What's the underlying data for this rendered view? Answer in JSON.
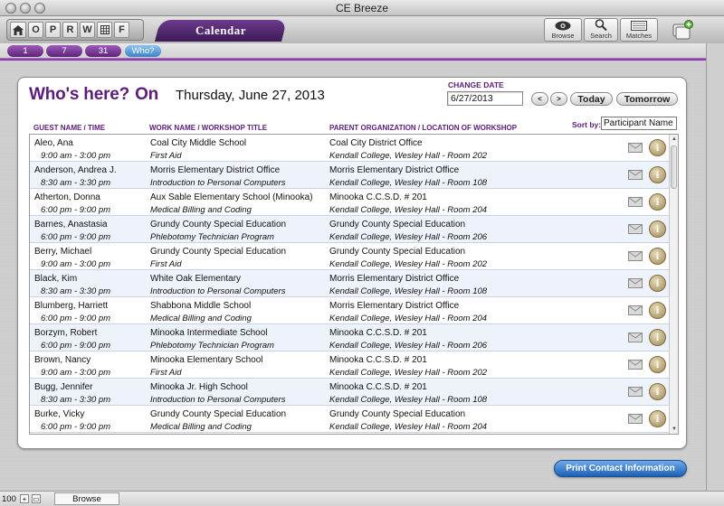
{
  "window": {
    "title": "CE Breeze"
  },
  "toolbar": {
    "nav_letters": [
      "O",
      "P",
      "R",
      "W",
      "F"
    ],
    "section_tab": "Calendar",
    "tools": [
      {
        "label": "Browse",
        "icon": "eye-icon"
      },
      {
        "label": "Search",
        "icon": "magnifier-icon"
      },
      {
        "label": "Matches",
        "icon": "list-icon"
      }
    ]
  },
  "view_tabs": [
    "1",
    "7",
    "31",
    "Who?"
  ],
  "panel": {
    "title": "Who's here?",
    "title_on": "On",
    "date_display": "Thursday, June 27, 2013",
    "change_date_label": "CHANGE DATE",
    "date_value": "6/27/2013",
    "prev_label": "<",
    "next_label": ">",
    "today_label": "Today",
    "tomorrow_label": "Tomorrow",
    "sort_by_label": "Sort by:",
    "sort_value": "Participant Name",
    "columns": [
      "GUEST NAME / TIME",
      "WORK NAME / WORKSHOP TITLE",
      "PARENT ORGANIZATION / LOCATION OF WORKSHOP"
    ]
  },
  "rows": [
    {
      "name": "Aleo, Ana",
      "time": "9:00 am - 3:00 pm",
      "work": "Coal City Middle School",
      "workshop": "First Aid",
      "org": "Coal City District Office",
      "location": "Kendall College, Wesley Hall - Room 202"
    },
    {
      "name": "Anderson, Andrea J.",
      "time": "8:30 am - 3:30 pm",
      "work": "Morris Elementary District Office",
      "workshop": "Introduction to Personal Computers",
      "org": "Morris Elementary District Office",
      "location": "Kendall College, Wesley Hall - Room 108"
    },
    {
      "name": "Atherton, Donna",
      "time": "6:00 pm - 9:00 pm",
      "work": "Aux Sable Elementary School (Minooka)",
      "workshop": "Medical Billing and Coding",
      "org": "Minooka C.C.S.D. # 201",
      "location": "Kendall College, Wesley Hall - Room 204"
    },
    {
      "name": "Barnes, Anastasia",
      "time": "6:00 pm - 9:00 pm",
      "work": "Grundy County Special Education",
      "workshop": "Phlebotomy Technician Program",
      "org": "Grundy County Special Education",
      "location": "Kendall College, Wesley Hall - Room 206"
    },
    {
      "name": "Berry, Michael",
      "time": "9:00 am - 3:00 pm",
      "work": "Grundy County Special Education",
      "workshop": "First Aid",
      "org": "Grundy County Special Education",
      "location": "Kendall College, Wesley Hall - Room 202"
    },
    {
      "name": "Black, Kim",
      "time": "8:30 am - 3:30 pm",
      "work": "White Oak Elementary",
      "workshop": "Introduction to Personal Computers",
      "org": "Morris Elementary District Office",
      "location": "Kendall College, Wesley Hall - Room 108"
    },
    {
      "name": "Blumberg, Harriett",
      "time": "6:00 pm - 9:00 pm",
      "work": "Shabbona Middle School",
      "workshop": "Medical Billing and Coding",
      "org": "Morris Elementary District Office",
      "location": "Kendall College, Wesley Hall - Room 204"
    },
    {
      "name": "Borzym, Robert",
      "time": "6:00 pm - 9:00 pm",
      "work": "Minooka Intermediate School",
      "workshop": "Phlebotomy Technician Program",
      "org": "Minooka C.C.S.D. # 201",
      "location": "Kendall College, Wesley Hall - Room 206"
    },
    {
      "name": "Brown, Nancy",
      "time": "9:00 am - 3:00 pm",
      "work": "Minooka Elementary School",
      "workshop": "First Aid",
      "org": "Minooka C.C.S.D. # 201",
      "location": "Kendall College, Wesley Hall - Room 202"
    },
    {
      "name": "Bugg, Jennifer",
      "time": "8:30 am - 3:30 pm",
      "work": "Minooka Jr. High School",
      "workshop": "Introduction to Personal Computers",
      "org": "Minooka C.C.S.D. # 201",
      "location": "Kendall College, Wesley Hall - Room 108"
    },
    {
      "name": "Burke, Vicky",
      "time": "6:00 pm - 9:00 pm",
      "work": "Grundy County Special Education",
      "workshop": "Medical Billing and Coding",
      "org": "Grundy County Special Education",
      "location": "Kendall College, Wesley Hall - Room 204"
    }
  ],
  "print_button": "Print Contact Information",
  "status": {
    "zoom": "100",
    "mode": "Browse"
  }
}
